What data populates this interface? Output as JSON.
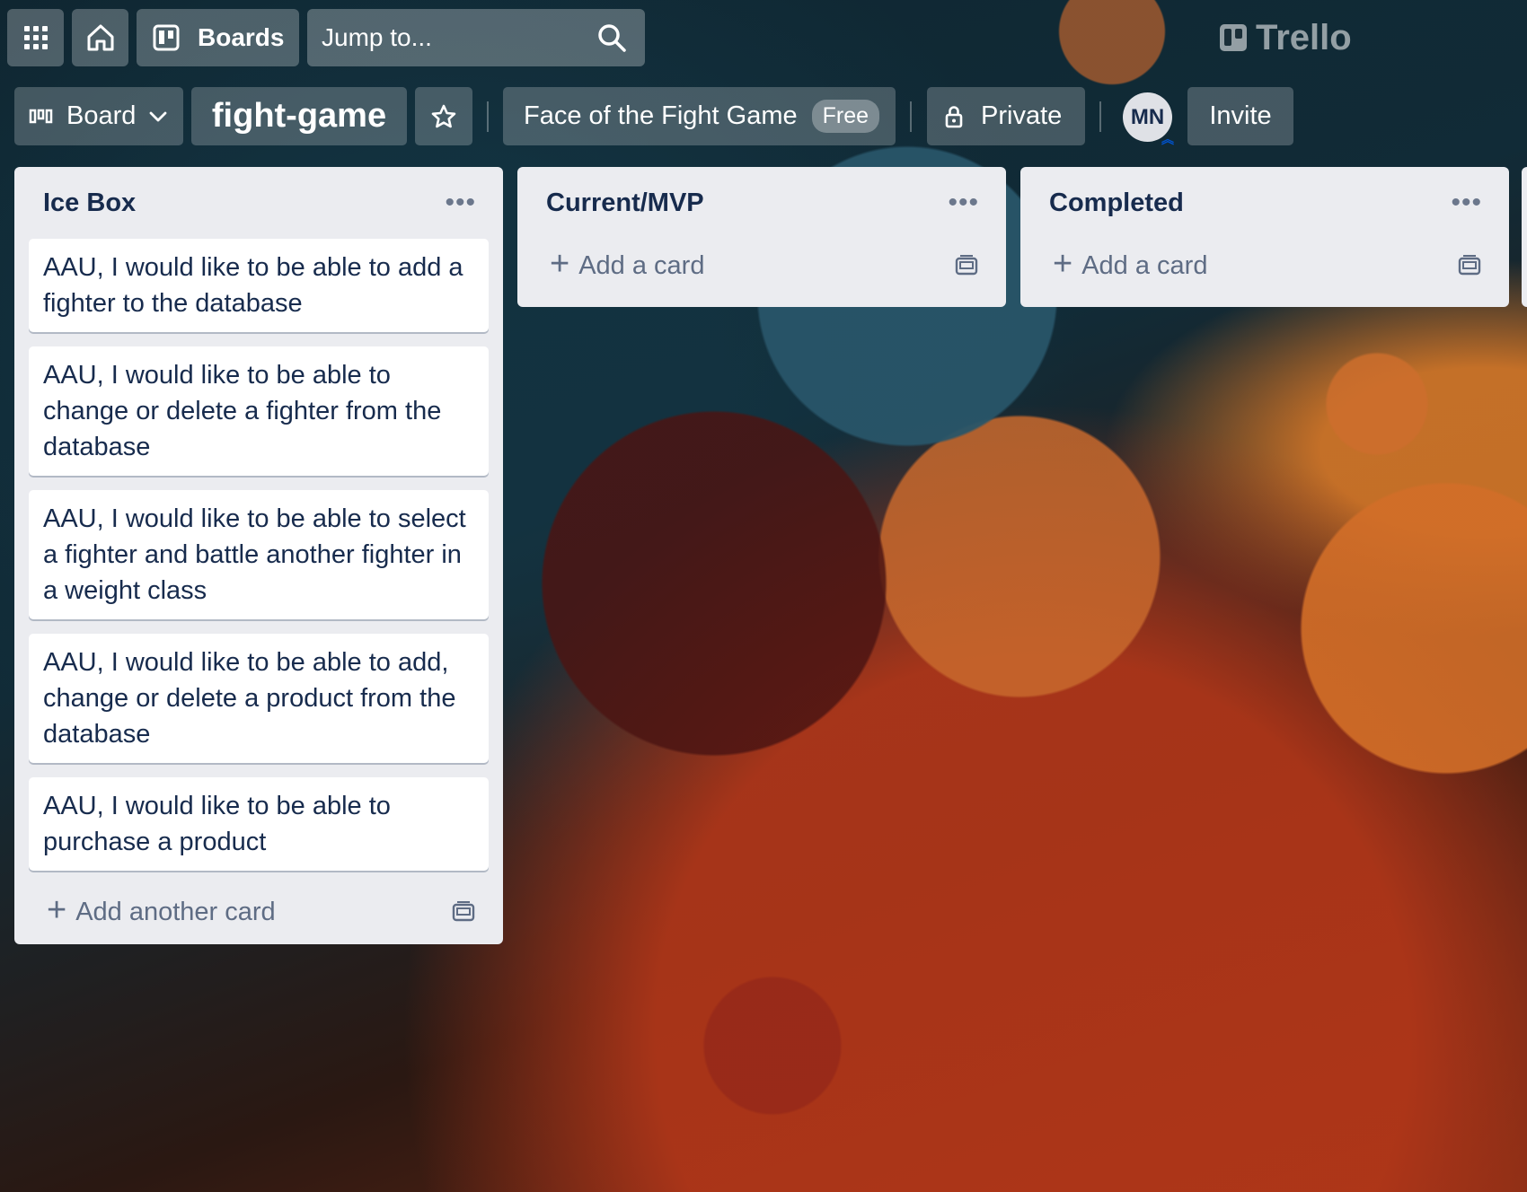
{
  "nav": {
    "boards_label": "Boards",
    "search_placeholder": "Jump to...",
    "brand": "Trello"
  },
  "board": {
    "view_label": "Board",
    "title": "fight-game",
    "workspace_name": "Face of the Fight Game",
    "workspace_badge": "Free",
    "privacy_label": "Private",
    "member_initials": "MN",
    "invite_label": "Invite"
  },
  "lists": [
    {
      "title": "Ice Box",
      "cards": [
        "AAU, I would like to be able to add a fighter to the database",
        "AAU, I would like to be able to change or delete a fighter from the database",
        "AAU, I would like to be able to select a fighter and battle another fighter in a weight class",
        "AAU, I would like to be able to add, change or delete a product from the database",
        "AAU, I would like to be able to purchase a product"
      ],
      "add_label": "Add another card"
    },
    {
      "title": "Current/MVP",
      "cards": [],
      "add_label": "Add a card"
    },
    {
      "title": "Completed",
      "cards": [],
      "add_label": "Add a card"
    }
  ],
  "icons": [
    "apps-grid-icon",
    "home-icon",
    "boards-icon",
    "search-icon",
    "trello-logo-icon",
    "board-view-icon",
    "chevron-down-icon",
    "star-icon",
    "lock-icon",
    "more-icon",
    "plus-icon",
    "template-icon"
  ],
  "colors": {
    "list_bg": "#ebecf0",
    "card_bg": "#ffffff",
    "text": "#172b4d",
    "muted": "#5e6c84"
  }
}
